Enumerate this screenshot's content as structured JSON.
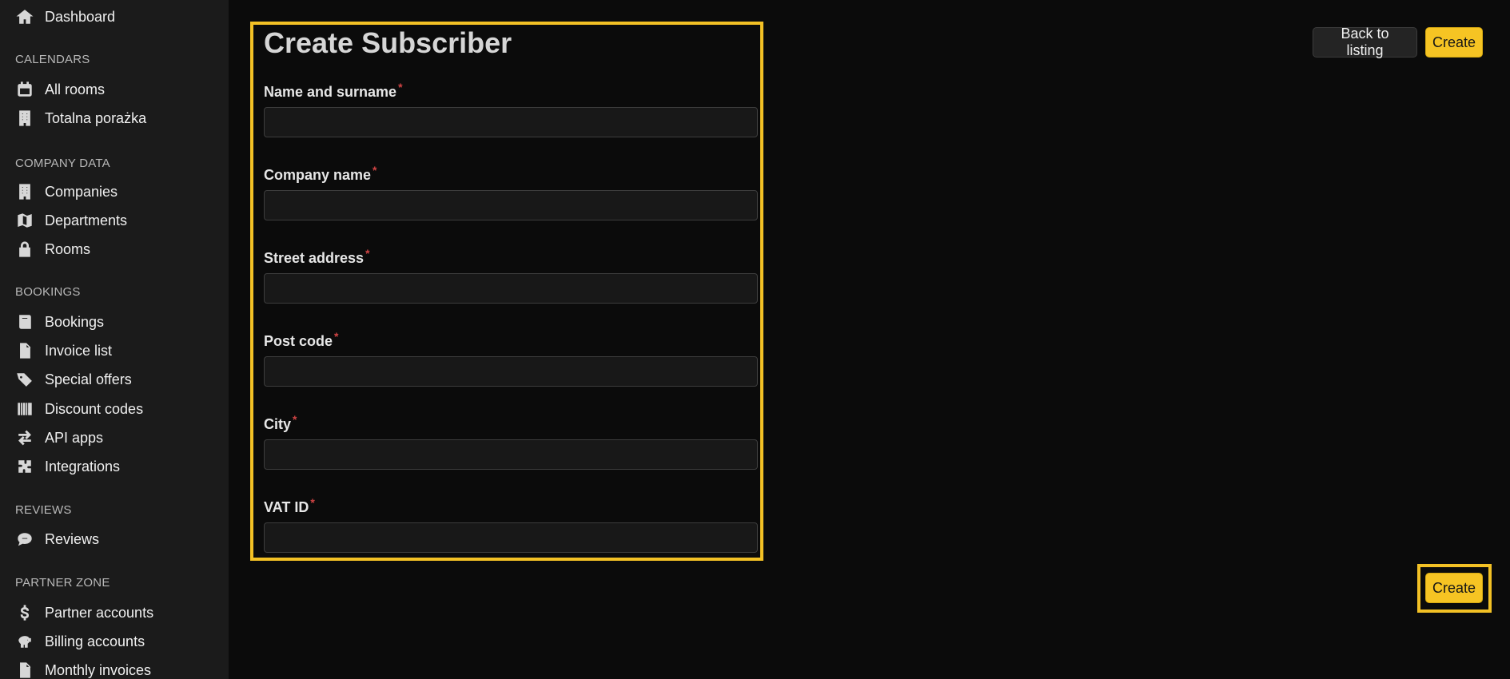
{
  "sidebar": {
    "top_items": [
      {
        "label": "Dashboard",
        "icon": "home-icon"
      }
    ],
    "sections": [
      {
        "title": "CALENDARS",
        "items": [
          {
            "label": "All rooms",
            "icon": "calendar-icon"
          },
          {
            "label": "Totalna porażka",
            "icon": "building-icon"
          }
        ]
      },
      {
        "title": "COMPANY DATA",
        "items": [
          {
            "label": "Companies",
            "icon": "building-icon"
          },
          {
            "label": "Departments",
            "icon": "map-icon"
          },
          {
            "label": "Rooms",
            "icon": "lock-icon"
          }
        ]
      },
      {
        "title": "BOOKINGS",
        "items": [
          {
            "label": "Bookings",
            "icon": "book-icon"
          },
          {
            "label": "Invoice list",
            "icon": "file-icon"
          },
          {
            "label": "Special offers",
            "icon": "tags-icon"
          },
          {
            "label": "Discount codes",
            "icon": "barcode-icon"
          },
          {
            "label": "API apps",
            "icon": "exchange-icon"
          },
          {
            "label": "Integrations",
            "icon": "puzzle-icon"
          }
        ]
      },
      {
        "title": "REVIEWS",
        "items": [
          {
            "label": "Reviews",
            "icon": "comment-icon"
          }
        ]
      },
      {
        "title": "PARTNER ZONE",
        "items": [
          {
            "label": "Partner accounts",
            "icon": "dollar-icon"
          },
          {
            "label": "Billing accounts",
            "icon": "piggy-bank-icon"
          },
          {
            "label": "Monthly invoices",
            "icon": "file-icon"
          }
        ]
      }
    ]
  },
  "page": {
    "title": "Create Subscriber",
    "header_buttons": {
      "back": "Back to listing",
      "create": "Create"
    },
    "bottom_button": "Create"
  },
  "form": {
    "required_symbol": "*",
    "fields": [
      {
        "label": "Name and surname",
        "value": "",
        "placeholder": ""
      },
      {
        "label": "Company name",
        "value": "",
        "placeholder": ""
      },
      {
        "label": "Street address",
        "value": "",
        "placeholder": ""
      },
      {
        "label": "Post code",
        "value": "",
        "placeholder": ""
      },
      {
        "label": "City",
        "value": "",
        "placeholder": ""
      },
      {
        "label": "VAT ID",
        "value": "",
        "placeholder": ""
      }
    ]
  },
  "colors": {
    "accent": "#f6c423",
    "highlight": "#f3c125",
    "required": "#d04444",
    "sidebar_background": "#1b1b1b",
    "page_background": "#0b0b0b"
  }
}
